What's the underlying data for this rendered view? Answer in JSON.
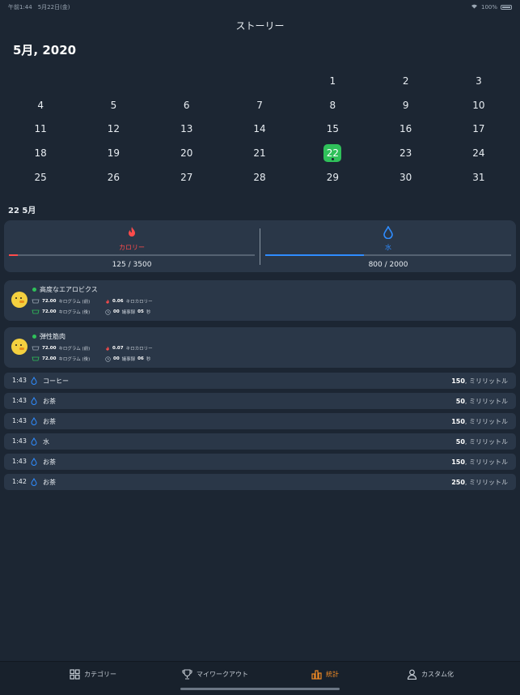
{
  "status_bar": {
    "time": "午前1:44　5月22日(金)",
    "battery": "100%"
  },
  "nav": {
    "title": "ストーリー"
  },
  "calendar": {
    "month_title": "5月, 2020",
    "days": [
      "",
      "",
      "",
      "",
      "1",
      "2",
      "3",
      "4",
      "5",
      "6",
      "7",
      "8",
      "9",
      "10",
      "11",
      "12",
      "13",
      "14",
      "15",
      "16",
      "17",
      "18",
      "19",
      "20",
      "21",
      "22",
      "23",
      "24",
      "25",
      "26",
      "27",
      "28",
      "29",
      "30",
      "31"
    ],
    "selected_day": "22"
  },
  "day_label": "22 5月",
  "summary": {
    "calories": {
      "label": "カロリー",
      "value": "125 / 3500",
      "progress": 0.036,
      "color": "#ff4b4b"
    },
    "water": {
      "label": "水",
      "value": "800 / 2000",
      "progress": 0.4,
      "color": "#2f8cff"
    }
  },
  "workouts": [
    {
      "name": "高度なエアロビクス",
      "weight_before_val": "72.00",
      "weight_before_unit": "キログラム (前)",
      "weight_after_val": "72.00",
      "weight_after_unit": "キログラム (後)",
      "kcal_val": "0.06",
      "kcal_unit": "キロカロリー",
      "dur_min": "00",
      "dur_min_unit": "議事録",
      "dur_sec": "05",
      "dur_sec_unit": "秒"
    },
    {
      "name": "弾性筋肉",
      "weight_before_val": "72.00",
      "weight_before_unit": "キログラム (前)",
      "weight_after_val": "72.00",
      "weight_after_unit": "キログラム (後)",
      "kcal_val": "0.07",
      "kcal_unit": "キロカロリー",
      "dur_min": "00",
      "dur_min_unit": "議事録",
      "dur_sec": "06",
      "dur_sec_unit": "秒"
    }
  ],
  "drinks": [
    {
      "time": "1:43",
      "name": "コーヒー",
      "amount": "150",
      "unit": ", ミリリットル"
    },
    {
      "time": "1:43",
      "name": "お茶",
      "amount": "50",
      "unit": ", ミリリットル"
    },
    {
      "time": "1:43",
      "name": "お茶",
      "amount": "150",
      "unit": ", ミリリットル"
    },
    {
      "time": "1:43",
      "name": "水",
      "amount": "50",
      "unit": ", ミリリットル"
    },
    {
      "time": "1:43",
      "name": "お茶",
      "amount": "150",
      "unit": ", ミリリットル"
    },
    {
      "time": "1:42",
      "name": "お茶",
      "amount": "250",
      "unit": ", ミリリットル"
    }
  ],
  "tabs": [
    {
      "label": "カテゴリー",
      "icon": "grid-icon",
      "active": false
    },
    {
      "label": "マイワークアウト",
      "icon": "trophy-icon",
      "active": false
    },
    {
      "label": "統計",
      "icon": "bar-chart-icon",
      "active": true
    },
    {
      "label": "カスタム化",
      "icon": "person-icon",
      "active": false
    }
  ]
}
